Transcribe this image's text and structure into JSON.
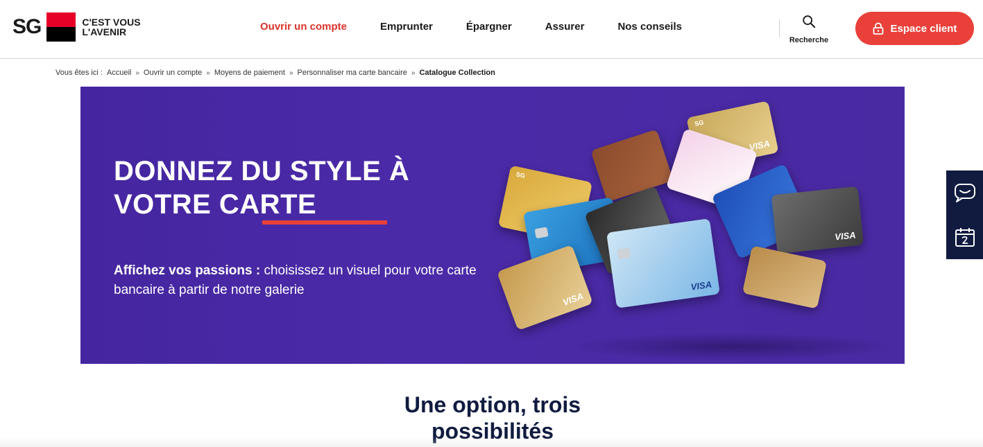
{
  "header": {
    "logo_text": "SG",
    "tagline_line1": "C'EST VOUS",
    "tagline_line2": "L'AVENIR",
    "nav": [
      {
        "label": "Ouvrir un compte",
        "active": true
      },
      {
        "label": "Emprunter",
        "active": false
      },
      {
        "label": "Épargner",
        "active": false
      },
      {
        "label": "Assurer",
        "active": false
      },
      {
        "label": "Nos conseils",
        "active": false
      }
    ],
    "search_label": "Recherche",
    "client_button_label": "Espace client"
  },
  "breadcrumb": {
    "prefix": "Vous êtes ici :",
    "items": [
      "Accueil",
      "Ouvrir un compte",
      "Moyens de paiement",
      "Personnaliser ma carte bancaire"
    ],
    "current": "Catalogue Collection"
  },
  "hero": {
    "title": "DONNEZ DU STYLE À VOTRE CARTE",
    "text_bold": "Affichez vos passions :",
    "text_rest": " choisissez un visuel pour votre carte bancaire à partir de notre galerie",
    "card_brand": "VISA",
    "card_bank": "SG"
  },
  "section": {
    "title": "Une option, trois possibilités"
  },
  "colors": {
    "accent_red": "#e9413a",
    "active_nav": "#d9342b",
    "hero_purple": "#4526a0",
    "navy": "#101b3f"
  },
  "icons": {
    "search": "search-icon",
    "lock": "lock-icon",
    "chat": "chat-icon",
    "calendar": "calendar-icon",
    "breadcrumb_sep": "double-chevron-right-icon"
  }
}
